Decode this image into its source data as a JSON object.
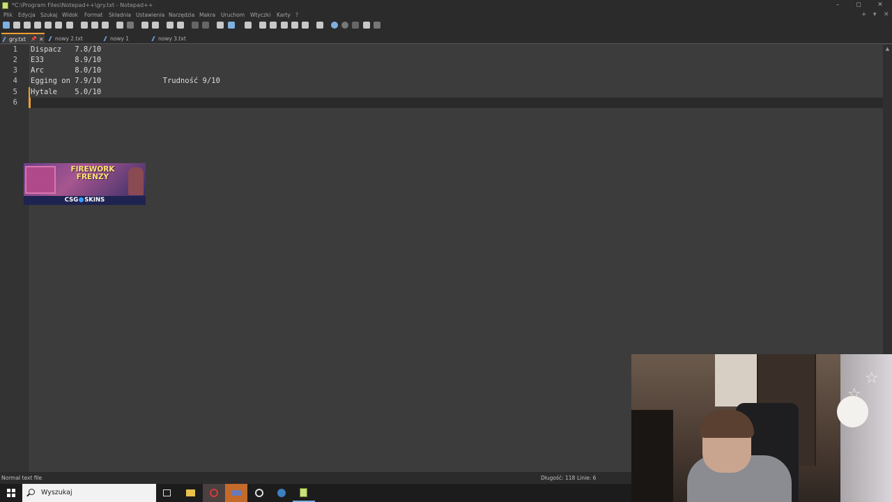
{
  "window": {
    "title": "*C:\\Program Files\\Notepad++\\gry.txt - Notepad++",
    "controls": [
      "–",
      "◻",
      "✕"
    ]
  },
  "menu": {
    "items": [
      "Plik",
      "Edycja",
      "Szukaj",
      "Widok",
      "Format",
      "Składnia",
      "Ustawienia",
      "Narzędzia",
      "Makra",
      "Uruchom",
      "Wtyczki",
      "Karty",
      "?"
    ],
    "right_controls": [
      "+",
      "▾",
      "✕"
    ]
  },
  "tabs": [
    {
      "label": "gry.txt",
      "active": true
    },
    {
      "label": "nowy 2.txt",
      "active": false
    },
    {
      "label": "nowy 1",
      "active": false
    },
    {
      "label": "nowy 3.txt",
      "active": false
    }
  ],
  "editor": {
    "line_numbers": [
      "1",
      "2",
      "3",
      "4",
      "5",
      "6"
    ],
    "lines": [
      "Dispacz   7.8/10",
      "E33       8.9/10",
      "Arc       8.0/10",
      "Egging on 7.9/10              Trudność 9/10",
      "Hytale    5.0/10",
      ""
    ],
    "current_line": 6
  },
  "ad": {
    "title_line1": "FIREWORK",
    "title_line2": "FRENZY",
    "brand_left": "CSG",
    "brand_right": "SKINS"
  },
  "status": {
    "file_type": "Normal text file",
    "length": "Długość: 118",
    "lines": "Linie: 6"
  },
  "taskbar": {
    "search_placeholder": "Wyszukaj"
  },
  "colors": {
    "accent": "#f0a030",
    "editor_bg": "#3c3c3c",
    "current_line_bg": "#2a2a2a",
    "chrome_bg": "#2b2b2b"
  }
}
